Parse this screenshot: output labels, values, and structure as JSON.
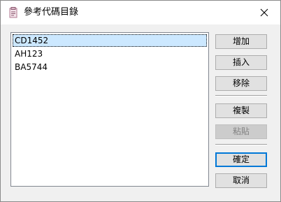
{
  "window": {
    "title": "參考代碼目錄",
    "app_icon": "clipboard-doc-icon",
    "close_icon": "close-icon"
  },
  "list": {
    "items": [
      {
        "label": "CD1452",
        "selected": true
      },
      {
        "label": "AH123",
        "selected": false
      },
      {
        "label": "BA5744",
        "selected": false
      }
    ]
  },
  "buttons": {
    "add": "增加",
    "insert": "插入",
    "remove": "移除",
    "copy": "複製",
    "paste": "粘貼",
    "ok": "確定",
    "cancel": "取消"
  },
  "state": {
    "paste_enabled": false,
    "default_button": "ok"
  },
  "colors": {
    "selection": "#cce8ff",
    "default_button_border": "#0078d7"
  }
}
